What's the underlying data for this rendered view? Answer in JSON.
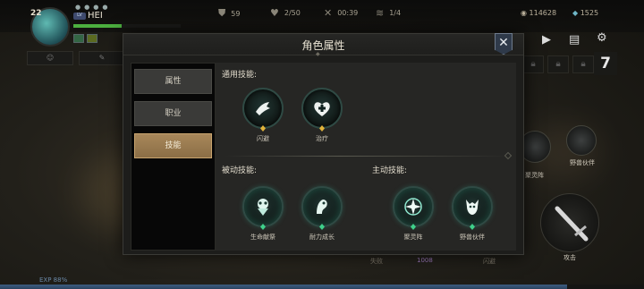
{
  "hud": {
    "level": "22",
    "player_name": "HEI",
    "hp_fraction": 0.45,
    "stats": [
      {
        "icon": "shield-icon",
        "value": "59"
      },
      {
        "icon": "heart-icon",
        "value": "2/50"
      },
      {
        "icon": "crossed-swords-icon",
        "value": "00:39"
      },
      {
        "icon": "chevron-rank-icon",
        "value": "1/4"
      }
    ],
    "currency": [
      {
        "icon": "coin-icon",
        "value": "114628"
      },
      {
        "icon": "gem-icon",
        "value": "1525"
      }
    ],
    "lock_slot_count": 4,
    "slot_number": "7",
    "side_skills": {
      "left": "聚灵阵",
      "right": "野兽伙伴"
    },
    "attack_label": "攻击",
    "exp_label": "EXP 88%",
    "exp_fraction": 0.88,
    "bottom_chips": [
      "失败",
      "1008",
      "闪避"
    ]
  },
  "modal": {
    "title": "角色属性",
    "close_label": "✕",
    "tabs": [
      {
        "label": "属性",
        "active": false
      },
      {
        "label": "职业",
        "active": false
      },
      {
        "label": "技能",
        "active": true
      }
    ],
    "sections": {
      "general": "通用技能:",
      "passive": "被动技能:",
      "active": "主动技能:"
    },
    "general_skills": [
      {
        "name": "闪避",
        "icon": "dodge-icon",
        "gem": "gold"
      },
      {
        "name": "治疗",
        "icon": "heal-icon",
        "gem": "gold"
      }
    ],
    "passive_skills": [
      {
        "name": "生命献祭",
        "icon": "life-sacrifice-icon",
        "gem": "green"
      },
      {
        "name": "耐力成长",
        "icon": "stamina-growth-icon",
        "gem": "green"
      }
    ],
    "active_skills": [
      {
        "name": "聚灵阵",
        "icon": "spirit-array-icon",
        "gem": "green"
      },
      {
        "name": "野兽伙伴",
        "icon": "beast-companion-icon",
        "gem": "green"
      }
    ]
  }
}
